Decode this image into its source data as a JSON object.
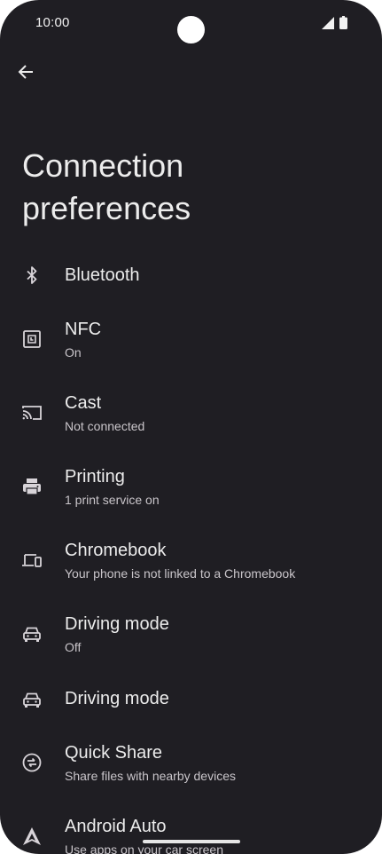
{
  "status_bar": {
    "time": "10:00"
  },
  "header": {
    "title": "Connection preferences"
  },
  "items": [
    {
      "id": "bluetooth",
      "icon": "bluetooth-icon",
      "title": "Bluetooth",
      "subtitle": ""
    },
    {
      "id": "nfc",
      "icon": "nfc-icon",
      "title": "NFC",
      "subtitle": "On"
    },
    {
      "id": "cast",
      "icon": "cast-icon",
      "title": "Cast",
      "subtitle": "Not connected"
    },
    {
      "id": "printing",
      "icon": "printer-icon",
      "title": "Printing",
      "subtitle": "1 print service on"
    },
    {
      "id": "chromebook",
      "icon": "devices-icon",
      "title": "Chromebook",
      "subtitle": "Your phone is not linked to a Chromebook"
    },
    {
      "id": "driving-mode-1",
      "icon": "car-icon",
      "title": "Driving mode",
      "subtitle": "Off"
    },
    {
      "id": "driving-mode-2",
      "icon": "car-icon",
      "title": "Driving mode",
      "subtitle": ""
    },
    {
      "id": "quick-share",
      "icon": "quick-share-icon",
      "title": "Quick Share",
      "subtitle": "Share files with nearby devices"
    },
    {
      "id": "android-auto",
      "icon": "android-auto-icon",
      "title": "Android Auto",
      "subtitle": "Use apps on your car screen"
    }
  ]
}
